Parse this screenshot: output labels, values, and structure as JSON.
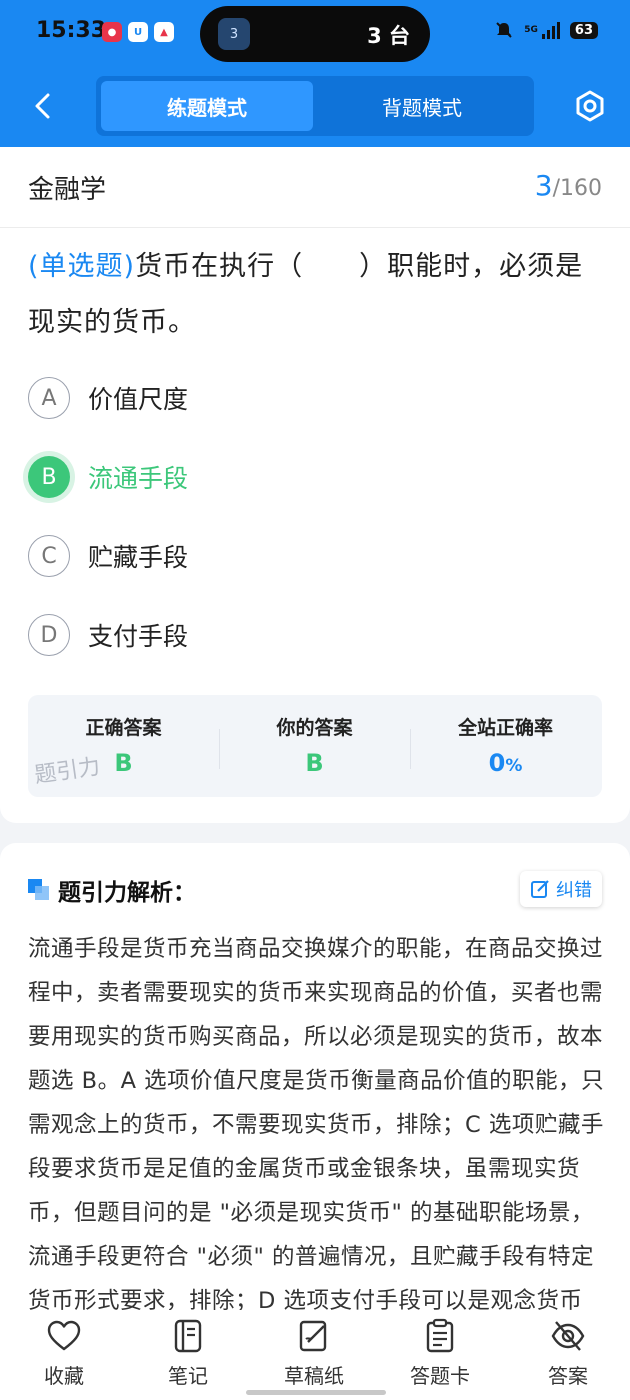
{
  "status": {
    "time": "15:33",
    "island_badge": "3",
    "island_text": "3 台",
    "network": "5G",
    "battery": "63"
  },
  "nav": {
    "tabs": [
      {
        "label": "练题模式",
        "active": true
      },
      {
        "label": "背题模式",
        "active": false
      }
    ]
  },
  "subject": {
    "name": "金融学",
    "current": "3",
    "separator": "/",
    "total": "160"
  },
  "question": {
    "type": "(单选题)",
    "text": "货币在执行（　　）职能时，必须是现实的货币。"
  },
  "options": [
    {
      "letter": "A",
      "text": "价值尺度",
      "selected": false
    },
    {
      "letter": "B",
      "text": "流通手段",
      "selected": true
    },
    {
      "letter": "C",
      "text": "贮藏手段",
      "selected": false
    },
    {
      "letter": "D",
      "text": "支付手段",
      "selected": false
    }
  ],
  "answer": {
    "correct_label": "正确答案",
    "correct_value": "B",
    "yours_label": "你的答案",
    "yours_value": "B",
    "rate_label": "全站正确率",
    "rate_value": "0",
    "rate_unit": "%",
    "watermark": "题引力"
  },
  "analysis": {
    "title": "题引力解析：",
    "report_label": "纠错",
    "body": "流通手段是货币充当商品交换媒介的职能，在商品交换过程中，卖者需要现实的货币来实现商品的价值，买者也需要用现实的货币购买商品，所以必须是现实的货币，故本题选 B。A 选项价值尺度是货币衡量商品价值的职能，只需观念上的货币，不需要现实货币，排除；C 选项贮藏手段要求货币是足值的金属货币或金银条块，虽需现实货币，但题目问的是 \"必须是现实货币\" 的基础职能场景，流通手段更符合 \"必须\" 的普遍情况，且贮藏手段有特定货币形式要求，排除；D 选项支付手段可以是观念货币"
  },
  "bottom_nav": [
    {
      "label": "收藏",
      "icon": "heart-icon"
    },
    {
      "label": "笔记",
      "icon": "notebook-icon"
    },
    {
      "label": "草稿纸",
      "icon": "draft-paper-icon"
    },
    {
      "label": "答题卡",
      "icon": "answer-sheet-icon"
    },
    {
      "label": "答案",
      "icon": "eye-off-icon"
    }
  ],
  "colors": {
    "brand_blue": "#1a88f2",
    "correct_green": "#3cc77a"
  }
}
